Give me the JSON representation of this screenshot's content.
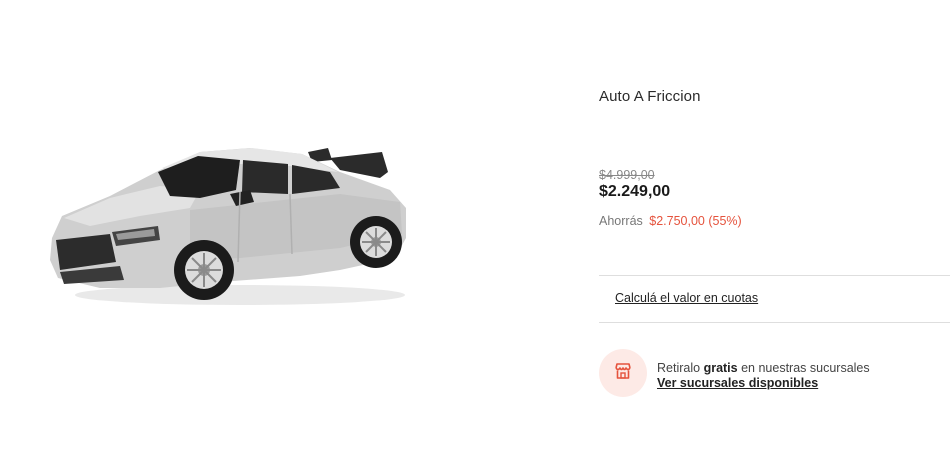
{
  "product": {
    "image_alt": "Auto A Friccion",
    "title": "Auto A Friccion",
    "old_price": "$4.999,00",
    "price": "$2.249,00",
    "saving_label": "Ahorrás",
    "saving_amount": "$2.750,00 (55%)"
  },
  "installments": {
    "link_label": "Calculá el valor en cuotas"
  },
  "pickup": {
    "icon": "store-icon",
    "text_before": "Retiralo",
    "text_bold": "gratis",
    "text_after": "en nuestras sucursales",
    "link_label": "Ver sucursales disponibles"
  },
  "colors": {
    "accent": "#e5533d",
    "badge_bg": "#fdeae6"
  }
}
